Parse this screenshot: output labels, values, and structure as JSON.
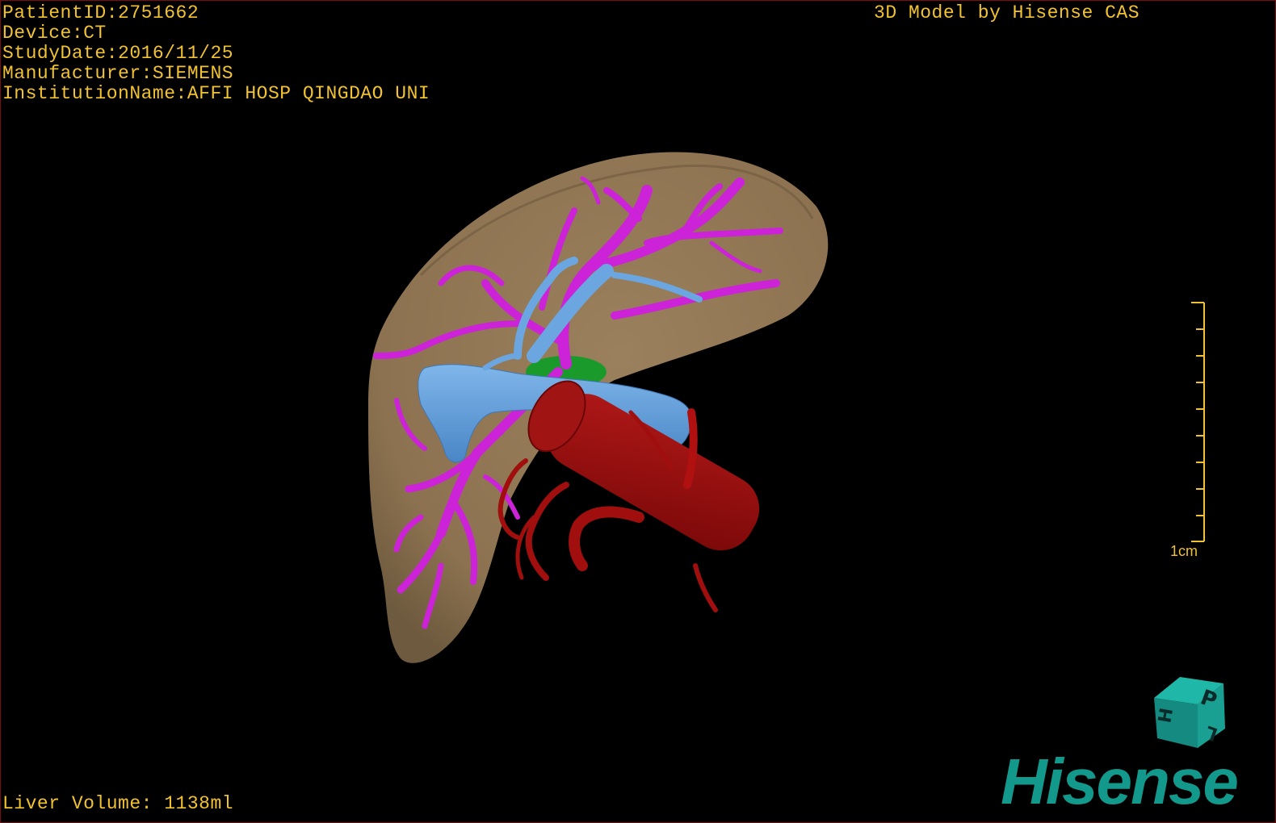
{
  "study_info": [
    "PatientID:2751662",
    "Device:CT",
    "StudyDate:2016/11/25",
    "Manufacturer:SIEMENS",
    "InstitutionName:AFFI HOSP QINGDAO UNI"
  ],
  "title_caption": "3D Model by Hisense CAS",
  "liver_volume": "Liver Volume: 1138ml",
  "scale_bar": {
    "label": "1cm"
  },
  "orientation_cube": {
    "faces": [
      "P",
      "H",
      "L"
    ],
    "icon": "orientation-cube-icon"
  },
  "brand": {
    "logo_text": "Hisense"
  },
  "model_structures": [
    {
      "name": "liver",
      "color": "#8c7250"
    },
    {
      "name": "hepatic-portal-vessels",
      "color": "#cc22d8"
    },
    {
      "name": "hepatic-veins",
      "color": "#5b9bd8"
    },
    {
      "name": "arteries",
      "color": "#9a0c0c"
    },
    {
      "name": "gallbladder",
      "color": "#1a9a2a"
    }
  ],
  "colors": {
    "overlay_text": "#f1c232",
    "brand": "#13988c",
    "background": "#000000"
  }
}
